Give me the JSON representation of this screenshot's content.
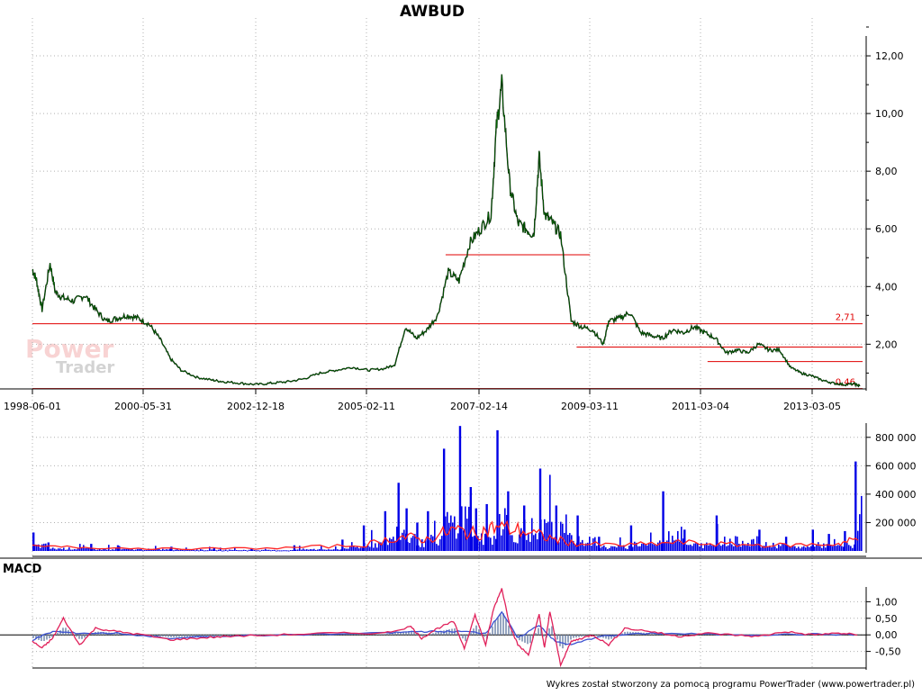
{
  "footer": "Wykres został stworzony za pomocą programu PowerTrader (www.powertrader.pl)",
  "watermark": {
    "line1": "Power",
    "line2": "Trader"
  },
  "colors": {
    "price_line": "#006400",
    "support_lines": "#e00000",
    "volume_bars": "#0000e6",
    "volume_avg": "#ff2020",
    "macd_line": "#e0205a",
    "macd_signal": "#3a50d0",
    "macd_hist": "#7a8fb0",
    "grid": "#b0b0b0"
  },
  "chart_data": [
    {
      "type": "line",
      "title": "AWBUD",
      "x_tick_labels": [
        "1998-06-01",
        "2000-05-31",
        "2002-12-18",
        "2005-02-11",
        "2007-02-14",
        "2009-03-11",
        "2011-03-04",
        "2013-03-05"
      ],
      "y_tick_labels": [
        "2,00",
        "4,00",
        "6,00",
        "8,00",
        "10,00",
        "12,00"
      ],
      "y_ticks": [
        2,
        4,
        6,
        8,
        10,
        12
      ],
      "ylim": [
        0.45,
        13.0
      ],
      "xlim": [
        1998.42,
        2013.95
      ],
      "grid": true,
      "series": [
        {
          "x": [
            1998.42,
            1998.5,
            1998.6,
            1998.75,
            1998.85,
            1999.0,
            1999.2,
            1999.4,
            1999.6,
            1999.8,
            2000.0,
            2000.2,
            2000.4,
            2000.6,
            2000.8,
            2001.0,
            2001.2,
            2001.5,
            2001.8,
            2002.0,
            2002.3,
            2002.6,
            2002.9,
            2003.2,
            2003.5,
            2003.8,
            2004.1,
            2004.4,
            2004.7,
            2005.0,
            2005.2,
            2005.4,
            2005.6,
            2005.8,
            2006.0,
            2006.2,
            2006.4,
            2006.6,
            2006.8,
            2007.0,
            2007.1,
            2007.2,
            2007.35,
            2007.5,
            2007.65,
            2007.8,
            2007.9,
            2008.0,
            2008.15,
            2008.3,
            2008.5,
            2008.7,
            2008.9,
            2009.1,
            2009.2,
            2009.4,
            2009.6,
            2009.8,
            2010.0,
            2010.2,
            2010.4,
            2010.6,
            2010.8,
            2011.0,
            2011.2,
            2011.4,
            2011.6,
            2011.8,
            2012.0,
            2012.2,
            2012.4,
            2012.6,
            2012.8,
            2013.0,
            2013.2,
            2013.4,
            2013.6,
            2013.8,
            2013.9
          ],
          "values": [
            4.6,
            4.2,
            3.2,
            4.8,
            3.8,
            3.6,
            3.5,
            3.7,
            3.2,
            2.8,
            2.9,
            3.0,
            2.9,
            2.7,
            2.2,
            1.5,
            1.1,
            0.85,
            0.75,
            0.7,
            0.65,
            0.6,
            0.65,
            0.7,
            0.8,
            1.0,
            1.1,
            1.2,
            1.1,
            1.15,
            1.3,
            2.6,
            2.2,
            2.5,
            3.0,
            4.5,
            4.2,
            5.5,
            6.0,
            6.5,
            9.5,
            11.0,
            7.5,
            6.2,
            6.0,
            5.8,
            8.5,
            6.5,
            6.2,
            5.8,
            2.8,
            2.6,
            2.5,
            2.0,
            2.8,
            2.9,
            3.1,
            2.4,
            2.3,
            2.2,
            2.5,
            2.4,
            2.6,
            2.4,
            2.2,
            1.7,
            1.8,
            1.7,
            2.0,
            1.8,
            1.8,
            1.2,
            1.0,
            0.9,
            0.75,
            0.65,
            0.6,
            0.62,
            0.55
          ]
        }
      ],
      "reference_lines": [
        {
          "value": 2.71,
          "label": "2,71",
          "x_from": 1998.42,
          "x_to": 2013.95
        },
        {
          "value": 0.46,
          "label": "0,46",
          "x_from": 1998.42,
          "x_to": 2013.95
        },
        {
          "value": 5.1,
          "x_from": 2006.15,
          "x_to": 2008.85
        },
        {
          "value": 1.9,
          "x_from": 2008.6,
          "x_to": 2013.95
        },
        {
          "value": 1.4,
          "x_from": 2011.05,
          "x_to": 2013.95
        }
      ]
    },
    {
      "type": "bar",
      "y_tick_labels": [
        "200 000",
        "400 000",
        "600 000",
        "800 000"
      ],
      "y_ticks": [
        200000,
        400000,
        600000,
        800000
      ],
      "ylim": [
        0,
        900000
      ],
      "xlim": [
        1998.42,
        2013.95
      ],
      "grid": true,
      "series": [
        {
          "x": [
            1998.42,
            1998.7,
            1999.5,
            2000.0,
            2001.0,
            2001.8,
            2002.5,
            2003.3,
            2004.2,
            2004.6,
            2005.0,
            2005.25,
            2005.4,
            2005.6,
            2005.8,
            2006.1,
            2006.4,
            2006.6,
            2006.7,
            2006.9,
            2007.1,
            2007.3,
            2007.6,
            2007.9,
            2008.2,
            2008.6,
            2009.0,
            2009.6,
            2010.2,
            2010.6,
            2011.2,
            2012.0,
            2012.5,
            2013.0,
            2013.3,
            2013.6,
            2013.8
          ],
          "values": [
            130000,
            60000,
            50000,
            40000,
            30000,
            25000,
            20000,
            40000,
            80000,
            180000,
            280000,
            480000,
            300000,
            200000,
            280000,
            720000,
            880000,
            450000,
            300000,
            330000,
            850000,
            420000,
            320000,
            580000,
            320000,
            250000,
            100000,
            180000,
            420000,
            150000,
            250000,
            150000,
            100000,
            150000,
            120000,
            140000,
            630000
          ]
        },
        {
          "x": [
            1998.42,
            1999.5,
            2001.0,
            2003.0,
            2004.6,
            2005.3,
            2005.8,
            2006.3,
            2006.7,
            2007.1,
            2007.6,
            2008.1,
            2008.6,
            2009.5,
            2010.5,
            2011.5,
            2012.5,
            2013.5,
            2013.9
          ],
          "values": [
            30000,
            25000,
            15000,
            20000,
            40000,
            100000,
            80000,
            150000,
            120000,
            170000,
            140000,
            90000,
            50000,
            40000,
            60000,
            45000,
            40000,
            50000,
            90000
          ]
        }
      ]
    },
    {
      "type": "line",
      "title": "MACD",
      "y_tick_labels": [
        "-0,50",
        "0,00",
        "0,50",
        "1,00"
      ],
      "y_ticks": [
        -0.5,
        0,
        0.5,
        1.0
      ],
      "ylim": [
        -1.0,
        1.5
      ],
      "xlim": [
        1998.42,
        2013.95
      ],
      "grid": true,
      "series": [
        {
          "x": [
            1998.42,
            1998.6,
            1998.8,
            1999.0,
            1999.3,
            1999.6,
            2000.0,
            2000.5,
            2001.0,
            2001.5,
            2002.0,
            2003.0,
            2004.0,
            2005.0,
            2005.5,
            2005.7,
            2006.0,
            2006.3,
            2006.5,
            2006.7,
            2006.9,
            2007.05,
            2007.2,
            2007.35,
            2007.5,
            2007.7,
            2007.9,
            2008.0,
            2008.1,
            2008.3,
            2008.5,
            2008.7,
            2008.9,
            2009.2,
            2009.5,
            2010.0,
            2010.5,
            2011.0,
            2011.5,
            2012.0,
            2012.5,
            2013.0,
            2013.5,
            2013.9
          ],
          "values": [
            -0.2,
            -0.4,
            -0.1,
            0.5,
            -0.3,
            0.2,
            0.1,
            0.0,
            -0.15,
            -0.1,
            -0.05,
            0.0,
            0.05,
            0.05,
            0.25,
            -0.1,
            0.2,
            0.4,
            -0.4,
            0.6,
            -0.3,
            0.8,
            1.4,
            0.3,
            -0.3,
            -0.6,
            0.6,
            -0.4,
            0.7,
            -0.9,
            -0.2,
            -0.1,
            0.0,
            -0.3,
            0.2,
            0.1,
            -0.05,
            0.05,
            0.0,
            -0.05,
            0.1,
            0.0,
            0.05,
            0.0
          ]
        },
        {
          "x": [
            1998.42,
            1998.8,
            1999.3,
            2000.0,
            2001.0,
            2003.0,
            2005.0,
            2005.6,
            2006.0,
            2006.5,
            2006.9,
            2007.2,
            2007.5,
            2007.9,
            2008.2,
            2008.5,
            2009.0,
            2010.0,
            2011.0,
            2012.0,
            2013.0,
            2013.9
          ],
          "values": [
            -0.15,
            0.1,
            0.05,
            0.05,
            -0.1,
            0.0,
            0.05,
            0.1,
            0.1,
            0.1,
            0.05,
            0.7,
            -0.1,
            0.3,
            -0.2,
            -0.3,
            -0.05,
            0.05,
            0.02,
            0.0,
            0.02,
            0.0
          ]
        }
      ]
    }
  ]
}
